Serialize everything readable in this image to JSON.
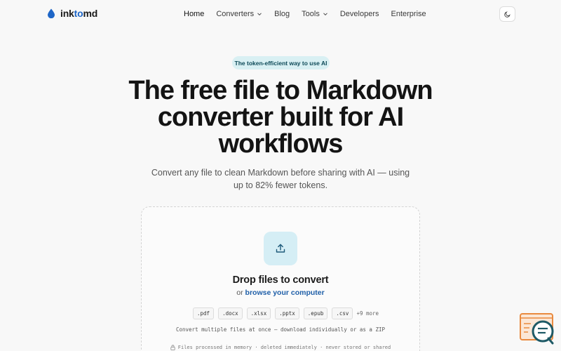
{
  "brand": {
    "name_prefix": "ink",
    "name_highlight": "to",
    "name_suffix": "md"
  },
  "nav": {
    "items": [
      {
        "label": "Home",
        "dropdown": false,
        "active": true
      },
      {
        "label": "Converters",
        "dropdown": true,
        "active": false
      },
      {
        "label": "Blog",
        "dropdown": false,
        "active": false
      },
      {
        "label": "Tools",
        "dropdown": true,
        "active": false
      },
      {
        "label": "Developers",
        "dropdown": false,
        "active": false
      },
      {
        "label": "Enterprise",
        "dropdown": false,
        "active": false
      }
    ],
    "theme_toggle_icon": "moon-icon"
  },
  "hero": {
    "badge": "The token-efficient way to use AI",
    "title": "The free file to Markdown converter built for AI workflows",
    "subtitle": "Convert any file to clean Markdown before sharing with AI — using up to 82% fewer tokens."
  },
  "dropzone": {
    "icon": "upload-icon",
    "title": "Drop files to convert",
    "or_text": "or",
    "browse_label": "browse your computer",
    "extensions": [
      ".pdf",
      ".docx",
      ".xlsx",
      ".pptx",
      ".epub",
      ".csv"
    ],
    "more_label": "+9 more",
    "multi_text": "Convert multiple files at once — download individually or as a ZIP",
    "privacy_icon": "lock-icon",
    "privacy_text": "Files processed in memory · deleted immediately · never stored or shared"
  },
  "colors": {
    "accent": "#1e66c7",
    "badge_bg": "#d9f0f3",
    "upload_tile_bg": "#d5eef5",
    "help_widget_orange": "#e98a3f",
    "help_widget_teal": "#1e5a66"
  },
  "help_widget": {
    "icon": "chat-help-icon"
  }
}
